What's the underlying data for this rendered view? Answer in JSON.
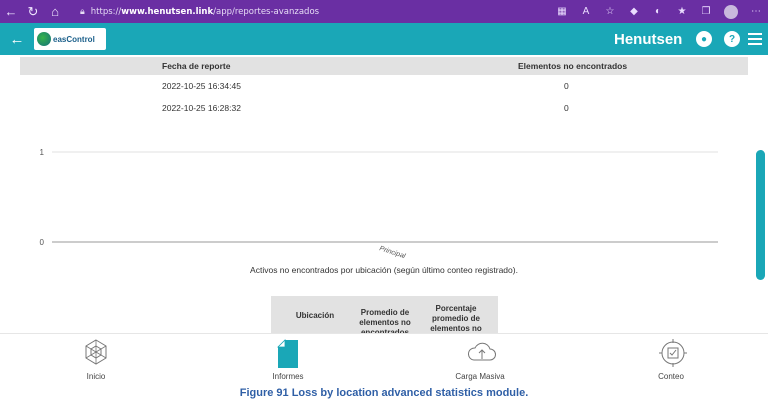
{
  "browser": {
    "url_prefix": "https://",
    "url_host": "www.henutsen.link",
    "url_path": "/app/reportes-avanzados"
  },
  "header": {
    "logo_text": "easControl",
    "brand": "Henutsen"
  },
  "report_table": {
    "headers": [
      "Fecha de reporte",
      "Elementos no encontrados"
    ],
    "rows": [
      {
        "date": "2022-10-25 16:34:45",
        "missing": "0"
      },
      {
        "date": "2022-10-25 16:28:32",
        "missing": "0"
      }
    ]
  },
  "chart_data": {
    "type": "bar",
    "categories": [
      "Principal"
    ],
    "values": [
      0
    ],
    "y_ticks": [
      "0",
      "1"
    ],
    "ylim": [
      0,
      1
    ],
    "caption": "Activos no encontrados por ubicación (según último conteo registrado).",
    "grid": true
  },
  "summary_table": {
    "headers": [
      "Ubicación",
      "Promedio de elementos no encontrados",
      "Porcentaje promedio de elementos no"
    ]
  },
  "bottom_nav": {
    "items": [
      {
        "label": "Inicio",
        "icon": "radar-icon"
      },
      {
        "label": "Informes",
        "icon": "document-icon",
        "accent": "#1aa7b7"
      },
      {
        "label": "Carga Masiva",
        "icon": "cloud-upload-icon"
      },
      {
        "label": "Conteo",
        "icon": "target-icon"
      }
    ]
  },
  "figure_caption": "Figure 91 Loss by location advanced statistics module.",
  "colors": {
    "browser_bar": "#6a2fa3",
    "app_header": "#1aa7b7",
    "caption_blue": "#2f5fa6"
  }
}
